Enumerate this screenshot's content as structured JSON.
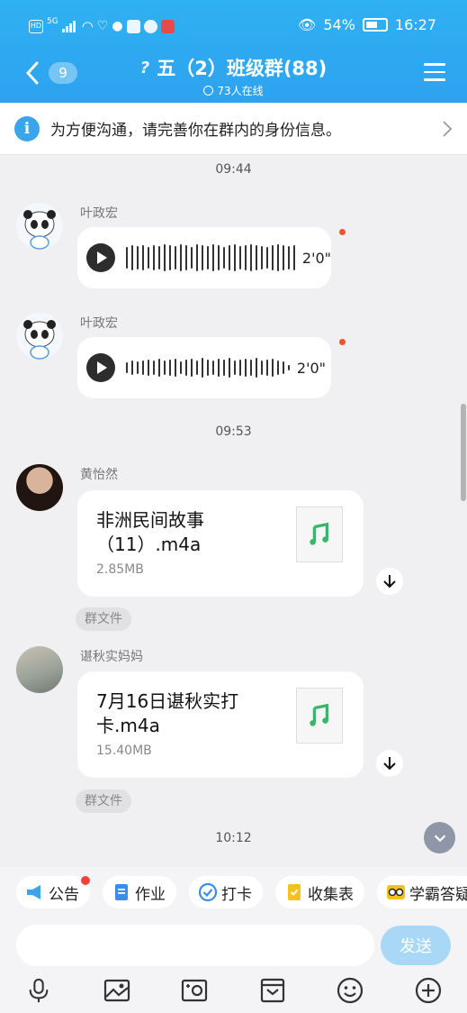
{
  "status_bar": {
    "left_labels": [
      "HD",
      "5G"
    ],
    "battery": "54%",
    "time": "16:27"
  },
  "header": {
    "back_badge": "9",
    "title": "五（2）班级群(88)",
    "online": "73人在线"
  },
  "info_bar": {
    "text": "为方便沟通，请完善你在群内的身份信息。"
  },
  "timestamps": [
    "09:44",
    "09:53",
    "10:12"
  ],
  "messages": [
    {
      "sender": "叶政宏",
      "type": "voice",
      "duration": "2'0\"",
      "unread": true
    },
    {
      "sender": "叶政宏",
      "type": "voice",
      "duration": "2'0\"",
      "unread": true
    },
    {
      "sender": "黄怡然",
      "type": "file",
      "file_name": "非洲民间故事（11）.m4a",
      "file_size": "2.85MB",
      "tag": "群文件"
    },
    {
      "sender": "谌秋实妈妈",
      "type": "file",
      "file_name": "7月16日谌秋实打卡.m4a",
      "file_size": "15.40MB",
      "tag": "群文件"
    }
  ],
  "toolbar_chips": [
    {
      "label": "公告",
      "icon": "megaphone-icon",
      "dot": true
    },
    {
      "label": "作业",
      "icon": "document-icon"
    },
    {
      "label": "打卡",
      "icon": "check-circle-icon"
    },
    {
      "label": "收集表",
      "icon": "form-icon"
    },
    {
      "label": "学霸答疑",
      "icon": "glasses-icon"
    }
  ],
  "composer": {
    "placeholder": "",
    "send_label": "发送"
  },
  "bottom_tools": [
    "microphone-icon",
    "image-icon",
    "camera-icon",
    "sticker-box-icon",
    "emoji-icon",
    "plus-icon"
  ],
  "colors": {
    "header": "#2ea8f2",
    "accent": "#3aa5ea",
    "unread_dot": "#f0532f",
    "send_disabled": "#a9d8f7"
  }
}
